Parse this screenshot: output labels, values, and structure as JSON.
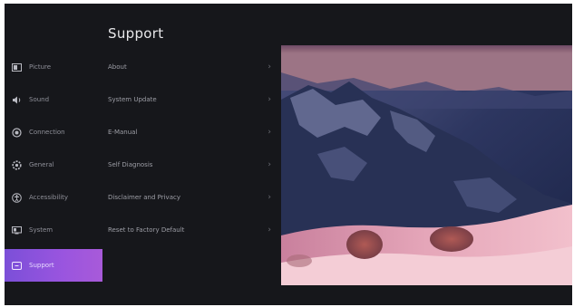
{
  "section_title": "Support",
  "nav": [
    {
      "label": "Picture",
      "icon": "picture-icon"
    },
    {
      "label": "Sound",
      "icon": "sound-icon"
    },
    {
      "label": "Connection",
      "icon": "connection-icon"
    },
    {
      "label": "General",
      "icon": "general-icon"
    },
    {
      "label": "Accessibility",
      "icon": "accessibility-icon"
    },
    {
      "label": "System",
      "icon": "system-icon"
    },
    {
      "label": "Support",
      "icon": "support-icon"
    }
  ],
  "active_nav": "Support",
  "menu": [
    {
      "label": "About"
    },
    {
      "label": "System Update"
    },
    {
      "label": "E-Manual"
    },
    {
      "label": "Self Diagnosis"
    },
    {
      "label": "Disclaimer and Privacy"
    },
    {
      "label": "Reset to Factory Default"
    }
  ],
  "colors": {
    "background": "#16171b",
    "accent": "#8a52dc"
  }
}
